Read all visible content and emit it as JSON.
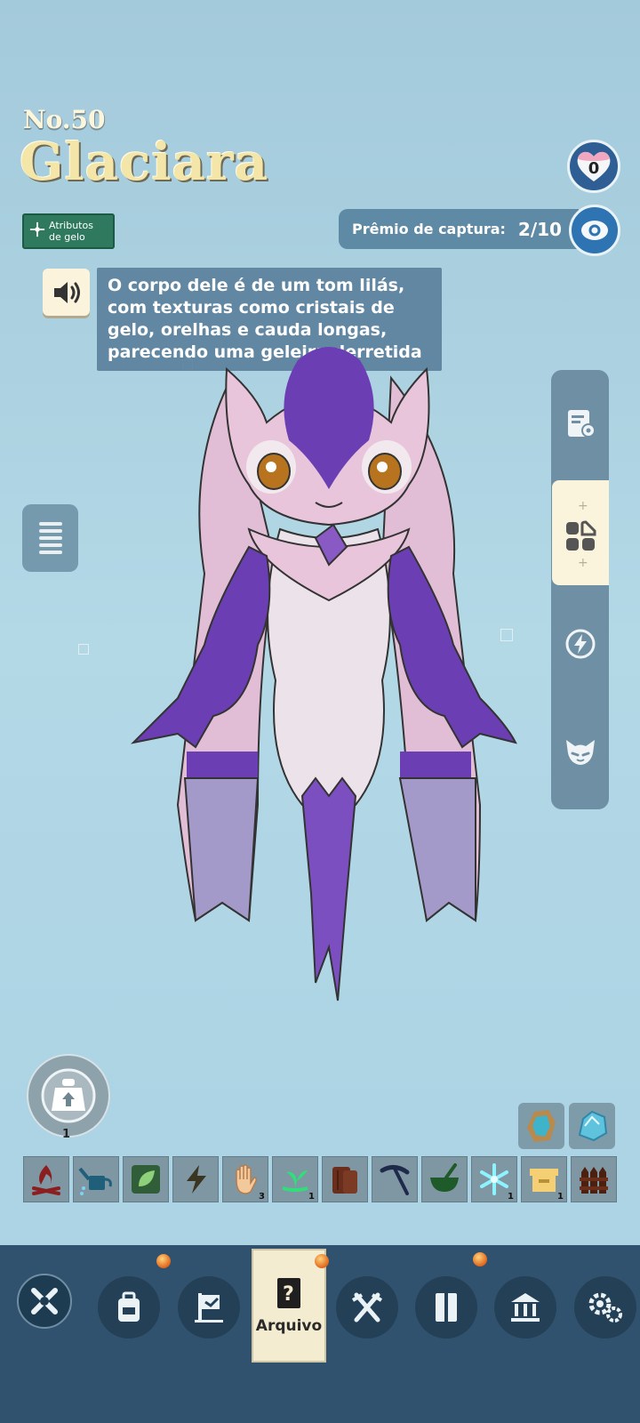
{
  "header": {
    "number": "No.50",
    "name": "Glaciara",
    "attribute_label": "Atributos de gelo",
    "heart_count": "0"
  },
  "capture": {
    "label": "Prêmio de captura:",
    "value": "2/10"
  },
  "description": "O corpo dele é de um tom lilás, com texturas como cristais de gelo, orelhas e cauda longas, parecendo uma geleira derretida",
  "weight": {
    "count": "1"
  },
  "skills": [
    {
      "icon": "campfire-icon",
      "count": ""
    },
    {
      "icon": "watering-can-icon",
      "count": ""
    },
    {
      "icon": "leaf-icon",
      "count": ""
    },
    {
      "icon": "lightning-icon",
      "count": ""
    },
    {
      "icon": "hand-icon",
      "count": "3"
    },
    {
      "icon": "sprout-icon",
      "count": "1"
    },
    {
      "icon": "log-icon",
      "count": ""
    },
    {
      "icon": "pickaxe-icon",
      "count": ""
    },
    {
      "icon": "mortar-icon",
      "count": ""
    },
    {
      "icon": "snowflake-icon",
      "count": "1"
    },
    {
      "icon": "crate-icon",
      "count": "1"
    },
    {
      "icon": "fence-icon",
      "count": ""
    }
  ],
  "nav": {
    "active_tab_label": "Arquivo"
  },
  "colors": {
    "accent": "#fbf4dc",
    "navbar": "#31526f",
    "attribute_badge": "#2f7a5f"
  }
}
